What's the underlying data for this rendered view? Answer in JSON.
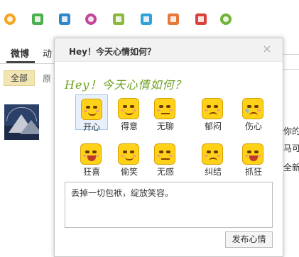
{
  "toolbar": {
    "icons": [
      {
        "name": "smiley-icon",
        "color": "#f3a623",
        "round": true
      },
      {
        "name": "image-icon",
        "color": "#4caf50",
        "round": false
      },
      {
        "name": "video-icon",
        "color": "#2f86c9",
        "round": false
      },
      {
        "name": "music-icon",
        "color": "#c2469b",
        "round": true
      },
      {
        "name": "topic-icon",
        "color": "#8db73b",
        "round": false
      },
      {
        "name": "tag-icon",
        "color": "#2fa3d6",
        "round": false
      },
      {
        "name": "chart-icon",
        "color": "#e8773a",
        "round": false
      },
      {
        "name": "poll-icon",
        "color": "#d9423b",
        "round": false
      },
      {
        "name": "app-icon",
        "color": "#6fb437",
        "round": true
      }
    ]
  },
  "background": {
    "tab_active": "微博",
    "tab_second": "动",
    "filter_all": "全部",
    "filter_second": "原",
    "side_texts": [
      "你的",
      "马可",
      "全新"
    ]
  },
  "dialog": {
    "title": "Hey！今天心情如何？",
    "close_label": "×",
    "heading": "Hey！今天心情如何？",
    "moods": [
      {
        "label": "开心",
        "selected": true,
        "mouth": "smile"
      },
      {
        "label": "得意",
        "selected": false,
        "mouth": "smile"
      },
      {
        "label": "无聊",
        "selected": false,
        "mouth": "flat"
      },
      {
        "label": "郁闷",
        "selected": false,
        "mouth": "sad"
      },
      {
        "label": "伤心",
        "selected": false,
        "mouth": "sad"
      },
      {
        "label": "狂喜",
        "selected": false,
        "mouth": "open"
      },
      {
        "label": "偷笑",
        "selected": false,
        "mouth": "smile"
      },
      {
        "label": "无感",
        "selected": false,
        "mouth": "flat"
      },
      {
        "label": "纠结",
        "selected": false,
        "mouth": "sad"
      },
      {
        "label": "抓狂",
        "selected": false,
        "mouth": "open"
      }
    ],
    "message_text": "丢掉一切包袱，绽放笑容。",
    "submit_label": "发布心情"
  },
  "colors": {
    "heading_green": "#6ea021",
    "emoji_yellow": "#ffd21a",
    "filter_bg": "#f1e6b3"
  }
}
